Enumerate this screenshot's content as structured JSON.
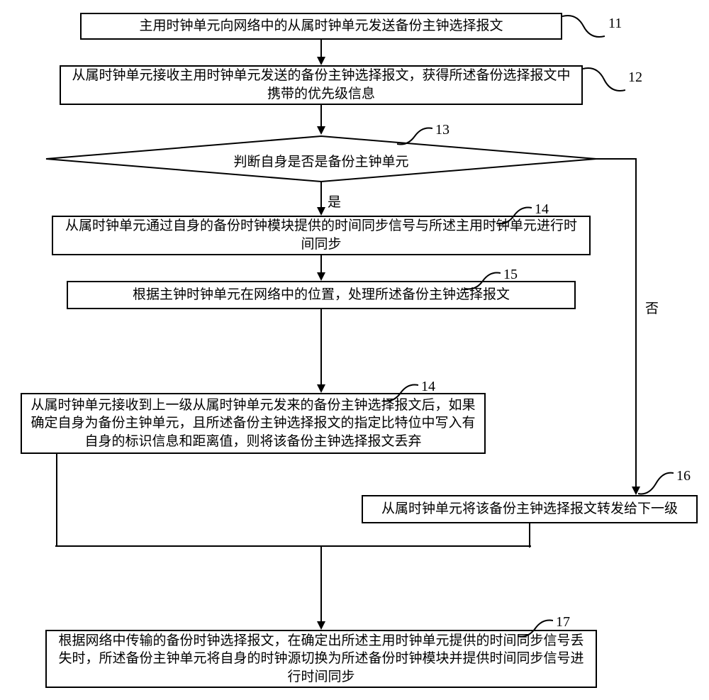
{
  "steps": {
    "s11": {
      "num": "11",
      "text": "主用时钟单元向网络中的从属时钟单元发送备份主钟选择报文"
    },
    "s12": {
      "num": "12",
      "text": "从属时钟单元接收主用时钟单元发送的备份主钟选择报文，获得所述备份选择报文中携带的优先级信息"
    },
    "s13": {
      "num": "13",
      "text": "判断自身是否是备份主钟单元"
    },
    "s14a": {
      "num": "14",
      "text": "从属时钟单元通过自身的备份时钟模块提供的时间同步信号与所述主用时钟单元进行时间同步"
    },
    "s15": {
      "num": "15",
      "text": "根据主钟时钟单元在网络中的位置，处理所述备份主钟选择报文"
    },
    "s14b": {
      "num": "14",
      "text": "从属时钟单元接收到上一级从属时钟单元发来的备份主钟选择报文后，如果确定自身为备份主钟单元，且所述备份主钟选择报文的指定比特位中写入有自身的标识信息和距离值，则将该备份主钟选择报文丢弃"
    },
    "s16": {
      "num": "16",
      "text": "从属时钟单元将该备份主钟选择报文转发给下一级"
    },
    "s17": {
      "num": "17",
      "text": "根据网络中传输的备份时钟选择报文，在确定出所述主用时钟单元提供的时间同步信号丢失时，所述备份主钟单元将自身的时钟源切换为所述备份时钟模块并提供时间同步信号进行时间同步"
    }
  },
  "labels": {
    "yes": "是",
    "no": "否"
  }
}
